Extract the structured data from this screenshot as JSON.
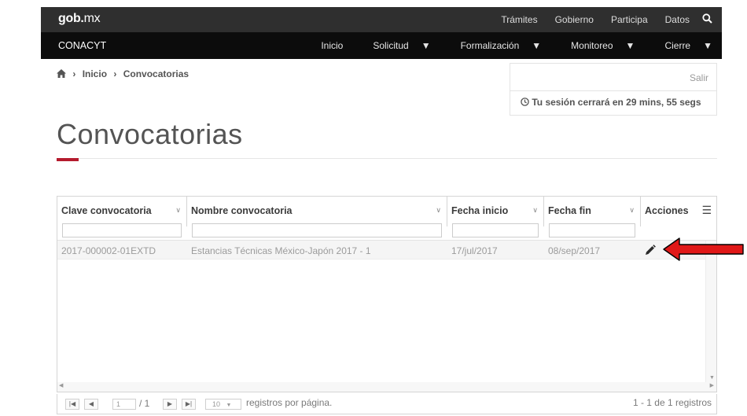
{
  "topbar": {
    "logo_main": "gob",
    "logo_dot": ".",
    "logo_suffix": "mx",
    "links": [
      "Trámites",
      "Gobierno",
      "Participa",
      "Datos"
    ]
  },
  "subbar": {
    "brand": "CONACYT",
    "links": [
      {
        "label": "Inicio",
        "dropdown": false
      },
      {
        "label": "Solicitud",
        "dropdown": true
      },
      {
        "label": "Formalización",
        "dropdown": true
      },
      {
        "label": "Monitoreo",
        "dropdown": true
      },
      {
        "label": "Cierre",
        "dropdown": true
      }
    ]
  },
  "breadcrumb": {
    "items": [
      "Inicio",
      "Convocatorias"
    ],
    "separator": "›"
  },
  "session": {
    "logout": "Salir",
    "timer": "Tu sesión cerrará en 29 mins, 55 segs"
  },
  "page": {
    "title": "Convocatorias",
    "accent_color": "#b51b2e"
  },
  "grid": {
    "columns": [
      "Clave convocatoria",
      "Nombre convocatoria",
      "Fecha inicio",
      "Fecha fin",
      "Acciones"
    ],
    "rows": [
      [
        "2017-000002-01EXTD",
        "Estancias Técnicas México-Japón 2017 - 1",
        "17/jul/2017",
        "08/sep/2017"
      ]
    ]
  },
  "pager": {
    "page_value": "1",
    "total_pages": "/ 1",
    "page_size": "10",
    "per_page_label": "registros por página.",
    "summary": "1 - 1 de 1 registros"
  }
}
